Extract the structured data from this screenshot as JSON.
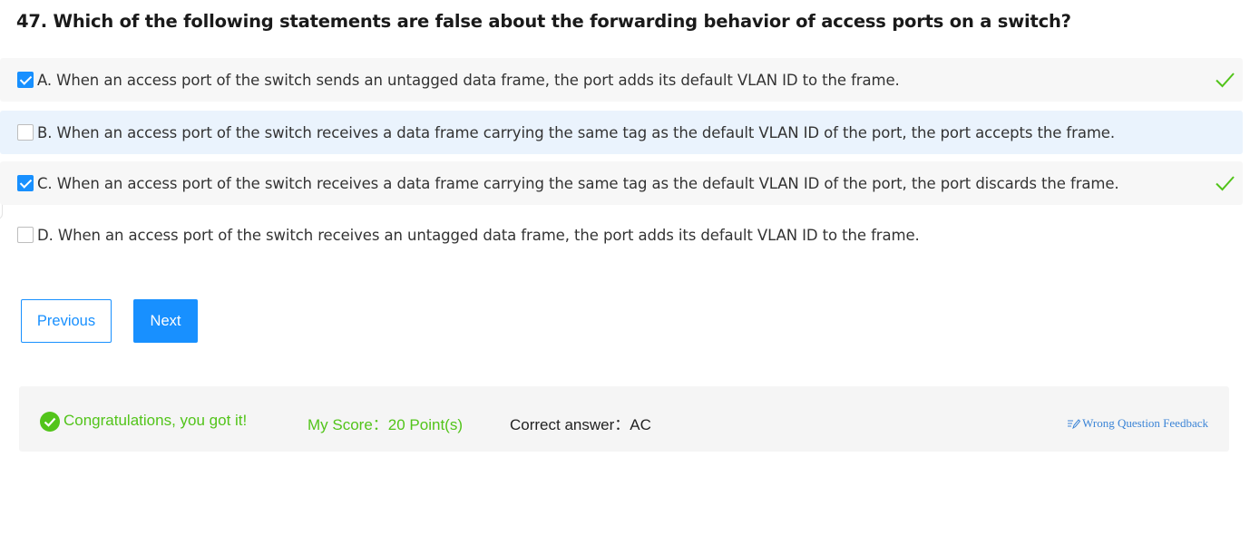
{
  "question": {
    "title": "47. Which of the following statements are false about the forwarding behavior of access ports on a switch?"
  },
  "options": [
    {
      "text": "A. When an access port of the switch sends an untagged data frame, the port adds its default VLAN ID to the frame.",
      "checked": true,
      "correct": true
    },
    {
      "text": "B. When an access port of the switch receives a data frame carrying the same tag as the default VLAN ID of the port, the port accepts the frame.",
      "checked": false,
      "correct": false
    },
    {
      "text": "C. When an access port of the switch receives a data frame carrying the same tag as the default VLAN ID of the port, the port discards the frame.",
      "checked": true,
      "correct": true
    },
    {
      "text": "D. When an access port of the switch receives an untagged data frame, the port adds its default VLAN ID to the frame.",
      "checked": false,
      "correct": false
    }
  ],
  "nav": {
    "previous_label": "Previous",
    "next_label": "Next"
  },
  "result": {
    "message": "Congratulations, you got it!",
    "score_text": "My Score：20 Point(s)",
    "answer_text": "Correct answer：AC",
    "feedback_label": "Wrong Question Feedback"
  },
  "colors": {
    "accent": "#1890ff",
    "success": "#52c41a",
    "hover_row": "#eaf3fd",
    "checked_row": "#f7f7f7",
    "result_bg": "#f5f5f5",
    "feedback_link": "#3b84d6"
  },
  "icons": {
    "checkbox_checked": "checkbox-checked-icon",
    "checkbox_unchecked": "checkbox-unchecked-icon",
    "correct": "checkmark-icon",
    "success": "check-circle-icon",
    "feedback": "edit-icon"
  }
}
